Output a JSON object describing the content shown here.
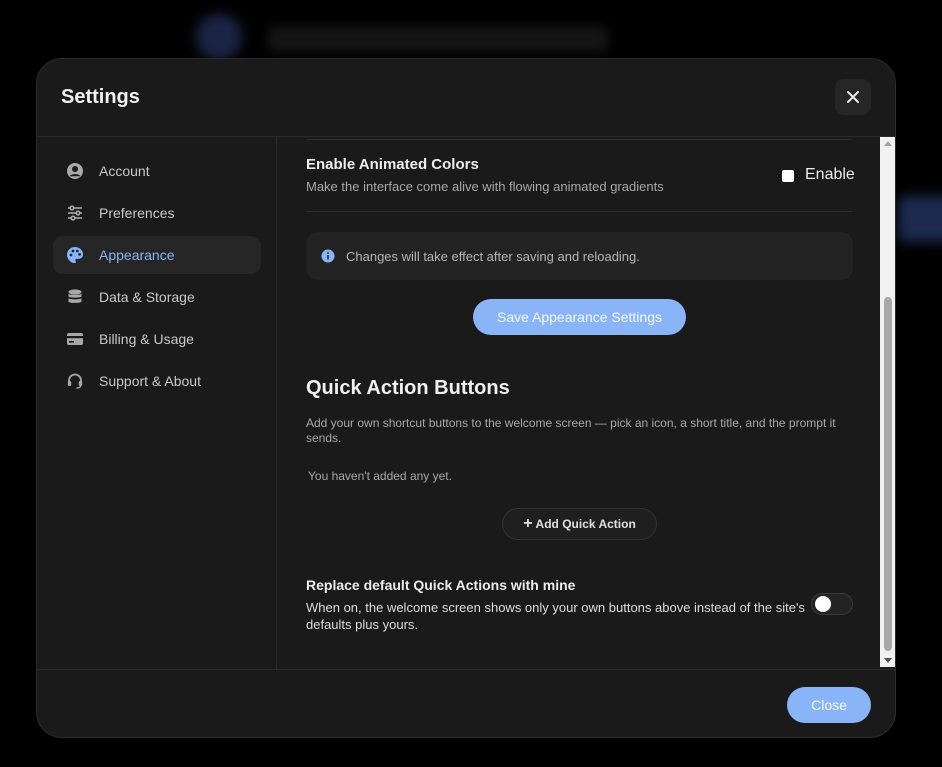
{
  "modal": {
    "title": "Settings",
    "close_icon": "close-icon"
  },
  "sidebar": {
    "items": [
      {
        "label": "Account",
        "icon": "account-icon",
        "active": false
      },
      {
        "label": "Preferences",
        "icon": "sliders-icon",
        "active": false
      },
      {
        "label": "Appearance",
        "icon": "palette-icon",
        "active": true
      },
      {
        "label": "Data & Storage",
        "icon": "database-icon",
        "active": false
      },
      {
        "label": "Billing & Usage",
        "icon": "credit-card-icon",
        "active": false
      },
      {
        "label": "Support & About",
        "icon": "headset-icon",
        "active": false
      }
    ]
  },
  "appearance": {
    "animated_colors": {
      "title": "Enable Animated Colors",
      "description": "Make the interface come alive with flowing animated gradients",
      "checkbox_label": "Enable",
      "checked": false
    },
    "info_note": "Changes will take effect after saving and reloading.",
    "save_button": "Save Appearance Settings"
  },
  "quick_actions": {
    "title": "Quick Action Buttons",
    "description": "Add your own shortcut buttons to the welcome screen — pick an icon, a short title, and the prompt it sends.",
    "empty_text": "You haven't added any yet.",
    "add_button": "Add Quick Action",
    "replace": {
      "title": "Replace default Quick Actions with mine",
      "description": "When on, the welcome screen shows only your own buttons above instead of the site's defaults plus yours.",
      "enabled": false
    }
  },
  "footer": {
    "close_button": "Close"
  },
  "colors": {
    "accent": "#8ab4f8",
    "panel": "#1a1a1a",
    "backdrop": "#000000"
  }
}
